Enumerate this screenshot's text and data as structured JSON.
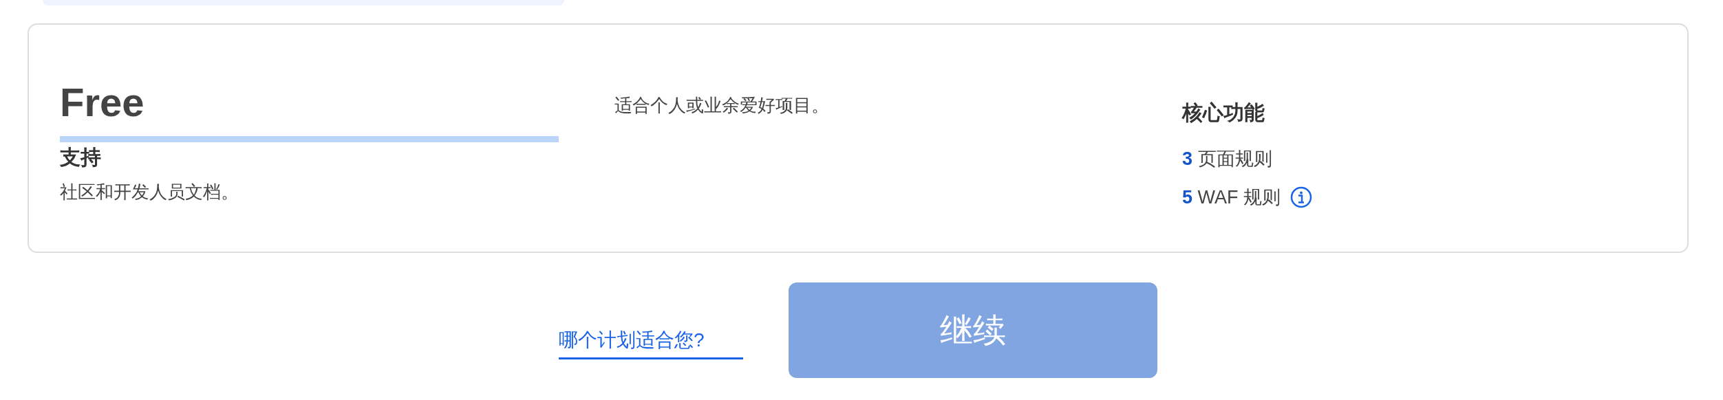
{
  "plan": {
    "name": "Free",
    "description": "适合个人或业余爱好项目。",
    "support": {
      "title": "支持",
      "text": "社区和开发人员文档。"
    },
    "features": {
      "title": "核心功能",
      "items": [
        {
          "count": "3",
          "label": "页面规则",
          "info": false
        },
        {
          "count": "5",
          "label": "WAF 规则",
          "info": true
        }
      ]
    }
  },
  "footer": {
    "help_link": "哪个计划适合您?",
    "continue_button": {
      "label": "继续",
      "disabled": true
    }
  }
}
